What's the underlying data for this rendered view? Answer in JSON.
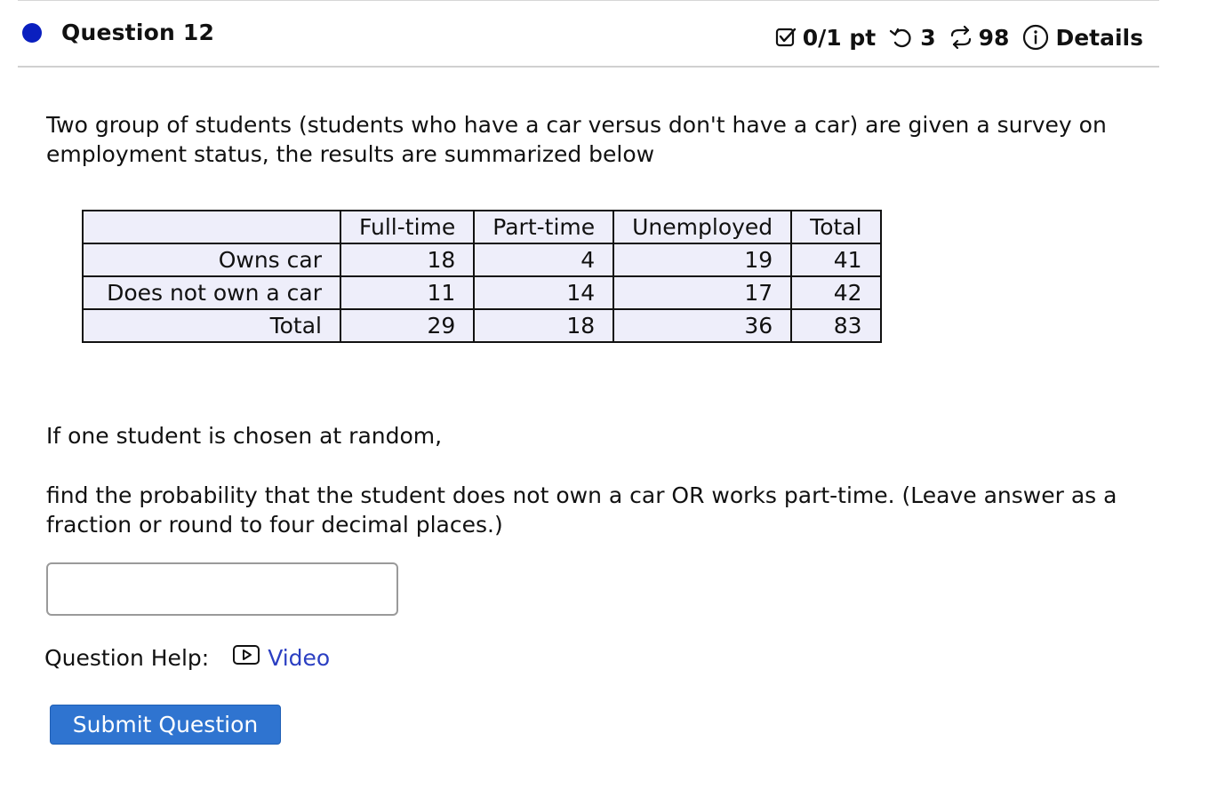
{
  "header": {
    "question_title": "Question 12",
    "score": "0/1 pt",
    "retries": "3",
    "submissions": "98",
    "details_label": "Details",
    "colors": {
      "dot": "#0a1fbf",
      "rule": "#d0d0d0"
    }
  },
  "question": {
    "prompt": "Two group of students (students who have a car versus don't have a car) are given a survey on employment status, the results are summarized below",
    "table": {
      "headers": [
        "",
        "Full-time",
        "Part-time",
        "Unemployed",
        "Total"
      ],
      "rows": [
        {
          "label": "Owns car",
          "values": [
            "18",
            "4",
            "19",
            "41"
          ]
        },
        {
          "label": "Does not own a car",
          "values": [
            "11",
            "14",
            "17",
            "42"
          ]
        },
        {
          "label": "Total",
          "values": [
            "29",
            "18",
            "36",
            "83"
          ]
        }
      ]
    },
    "line1": "If one student is chosen at random,",
    "line2": "find the probability that the student does not own a car OR works part-time. (Leave answer as a fraction or round to four decimal places.)",
    "answer_value": ""
  },
  "help": {
    "label": "Question Help:",
    "video_label": "Video",
    "video_icon": "play-icon"
  },
  "submit": {
    "label": "Submit Question",
    "color": "#2f74d0"
  }
}
